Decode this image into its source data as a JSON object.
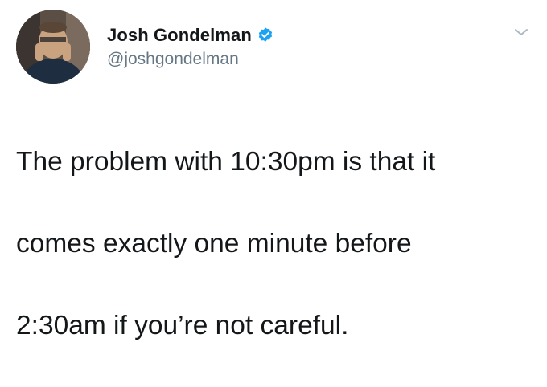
{
  "tweet": {
    "author": {
      "display_name": "Josh Gondelman",
      "handle": "@joshgondelman",
      "verified": true,
      "avatar_icon": "profile-photo"
    },
    "menu_icon": "chevron-down-icon",
    "text_lines": [
      "The problem with 10:30pm is that it",
      "comes exactly one minute before",
      "2:30am if you’re not careful."
    ]
  },
  "colors": {
    "verified_badge": "#1da1f2",
    "name": "#14171a",
    "handle": "#657786",
    "chevron": "#aab8c2"
  }
}
